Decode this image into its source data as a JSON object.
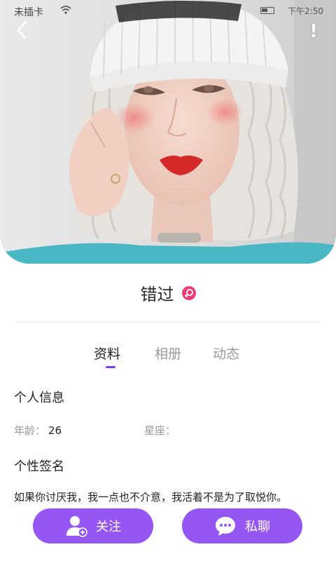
{
  "status_bar": {
    "carrier": "未插卡",
    "time": "下午2:50"
  },
  "profile": {
    "name": "错过",
    "gender_icon": "female-icon",
    "accent_color": "#7b3ff2",
    "button_color": "#9556f4"
  },
  "tabs": [
    {
      "label": "资料",
      "active": true
    },
    {
      "label": "相册",
      "active": false
    },
    {
      "label": "动态",
      "active": false
    }
  ],
  "personal_info": {
    "title": "个人信息",
    "age_label": "年龄：",
    "age_value": "26",
    "zodiac_label": "星座：",
    "zodiac_value": ""
  },
  "signature": {
    "title": "个性签名",
    "text": "如果你讨厌我，我一点也不介意，我活着不是为了取悦你。"
  },
  "actions": {
    "follow_label": "关注",
    "chat_label": "私聊"
  }
}
